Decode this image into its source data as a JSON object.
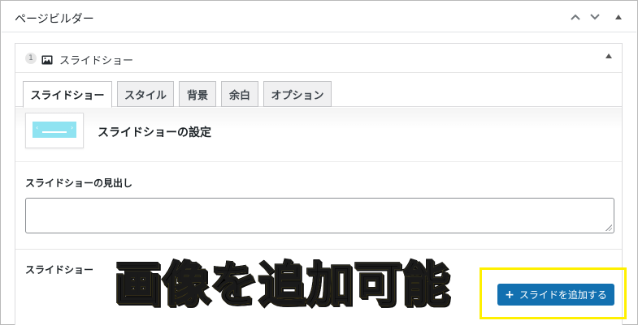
{
  "panel": {
    "title": "ページビルダー",
    "controls": [
      "chevron-up-icon",
      "chevron-down-icon",
      "triangle-up-icon"
    ]
  },
  "module": {
    "index": "1",
    "icon": "image-icon",
    "title": "スライドショー",
    "collapse_icon": "triangle-up-icon"
  },
  "tabs": [
    {
      "label": "スライドショー",
      "active": true
    },
    {
      "label": "スタイル",
      "active": false
    },
    {
      "label": "背景",
      "active": false
    },
    {
      "label": "余白",
      "active": false
    },
    {
      "label": "オプション",
      "active": false
    }
  ],
  "settings": {
    "title": "スライドショーの設定"
  },
  "fields": {
    "heading_label": "スライドショーの見出し",
    "heading_value": "",
    "slides_label": "スライドショー"
  },
  "add_button": {
    "label": "スライドを追加する",
    "icon": "plus-icon",
    "color": "#1270b0",
    "highlight_color": "#fff000"
  },
  "caption": {
    "text": "画像を追加可能"
  }
}
